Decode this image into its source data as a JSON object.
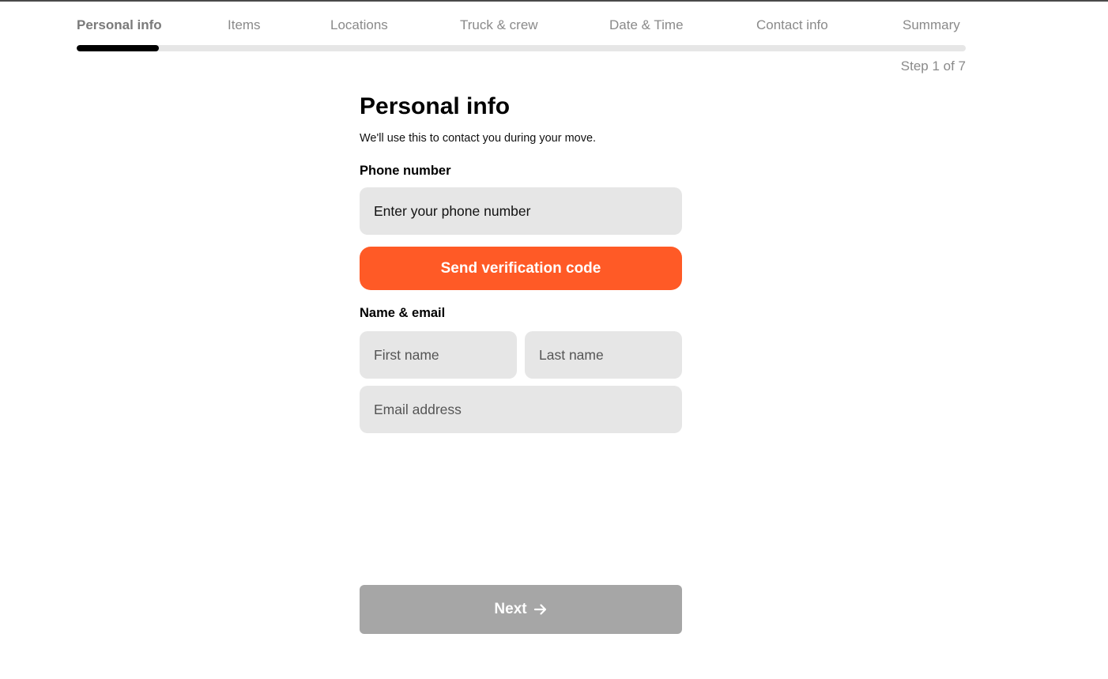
{
  "stepper": {
    "steps": [
      {
        "label": "Personal info",
        "active": true
      },
      {
        "label": "Items",
        "active": false
      },
      {
        "label": "Locations",
        "active": false
      },
      {
        "label": "Truck & crew",
        "active": false
      },
      {
        "label": "Date & Time",
        "active": false
      },
      {
        "label": "Contact info",
        "active": false
      },
      {
        "label": "Summary",
        "active": false
      }
    ],
    "progress_fraction": 0.0925,
    "counter": "Step 1 of 7"
  },
  "form": {
    "title": "Personal info",
    "subtitle": "We'll use this to contact you during your move.",
    "phone": {
      "label": "Phone number",
      "placeholder": "Enter your phone number",
      "value": ""
    },
    "verify_button": "Send verification code",
    "name_email": {
      "label": "Name & email",
      "first_name_placeholder": "First name",
      "last_name_placeholder": "Last name",
      "email_placeholder": "Email address"
    }
  },
  "next_button": {
    "label": "Next",
    "icon": "arrow-right-icon",
    "enabled": false
  },
  "colors": {
    "accent": "#ff5a26",
    "input_bg": "#e6e6e6",
    "disabled_button": "#a6a6a6",
    "progress": "#000000"
  }
}
